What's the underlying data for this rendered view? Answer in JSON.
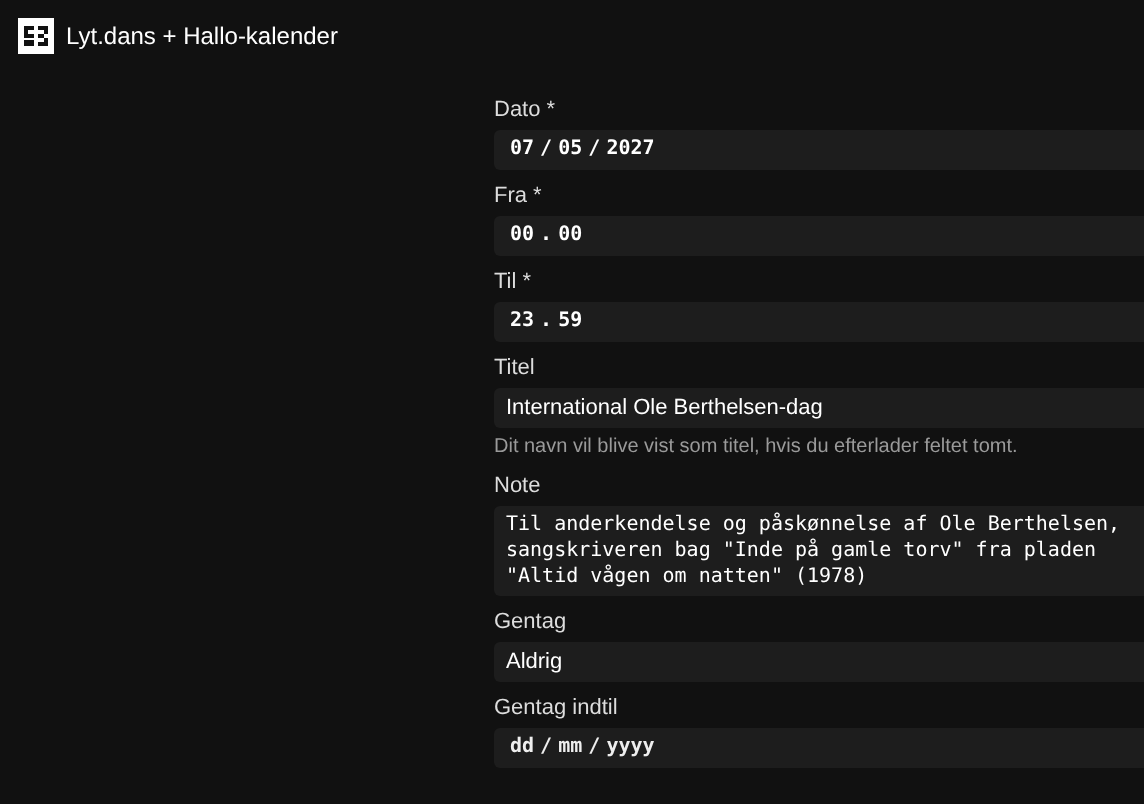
{
  "header": {
    "title": "Lyt.dans + Hallo-kalender"
  },
  "fields": [
    {
      "kind": "date",
      "label": "Dato *",
      "value": "07 / 05 / 2027"
    },
    {
      "kind": "time",
      "label": "Fra *",
      "value": "00 . 00"
    },
    {
      "kind": "time",
      "label": "Til *",
      "value": "23 . 59"
    },
    {
      "kind": "text",
      "label": "Titel",
      "value": "International Ole Berthelsen-dag",
      "help": "Dit navn vil blive vist som titel, hvis du efterlader feltet tomt."
    },
    {
      "kind": "textarea",
      "label": "Note",
      "value": "Til anderkendelse og påskønnelse af Ole Berthelsen,\nsangskriveren bag \"Inde på gamle torv\" fra pladen\n\"Altid vågen om natten\" (1978)"
    },
    {
      "kind": "select",
      "label": "Gentag",
      "value": "Aldrig"
    },
    {
      "kind": "date",
      "label": "Gentag indtil",
      "placeholder": "dd / mm / yyyy"
    }
  ]
}
